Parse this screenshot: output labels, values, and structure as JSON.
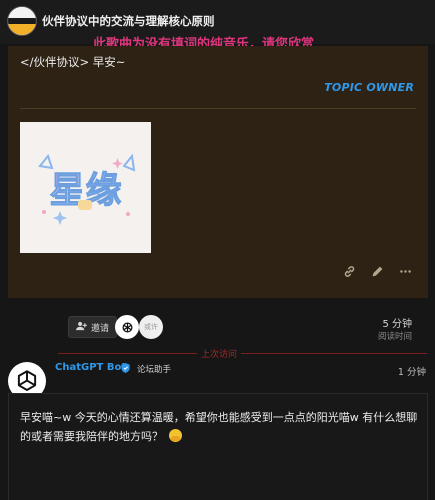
{
  "header": {
    "title": "伙伴协议中的交流与理解核心原则",
    "music_notice": "此歌曲为没有填词的纯音乐，请您欣赏",
    "logo_icon": "site-logo"
  },
  "original_post": {
    "greeting": "</伙伴协议> 早安~",
    "owner_label": "TOPIC OWNER",
    "image_text": "星缘",
    "actions": [
      "link-icon",
      "edit-icon",
      "more-icon"
    ]
  },
  "topic_meta": {
    "reply_label": "邀请",
    "participant_2_label": "或许",
    "read_time_value": "5 分钟",
    "read_time_label": "阅读时间"
  },
  "last_visit_label": "上次访问",
  "reply": {
    "author": "ChatGPT Bot",
    "role": "论坛助手",
    "time": "1 分钟",
    "text": "早安喵~w 今天的心情还算温暖，希望你也能感受到一点点的阳光喵w 有什么想聊的或者需要我陪伴的地方吗？"
  },
  "colors": {
    "accent": "#2f98e8",
    "banner": "#e0357c",
    "post_bg": "#2d2213",
    "last_visit": "#a12a2a"
  }
}
